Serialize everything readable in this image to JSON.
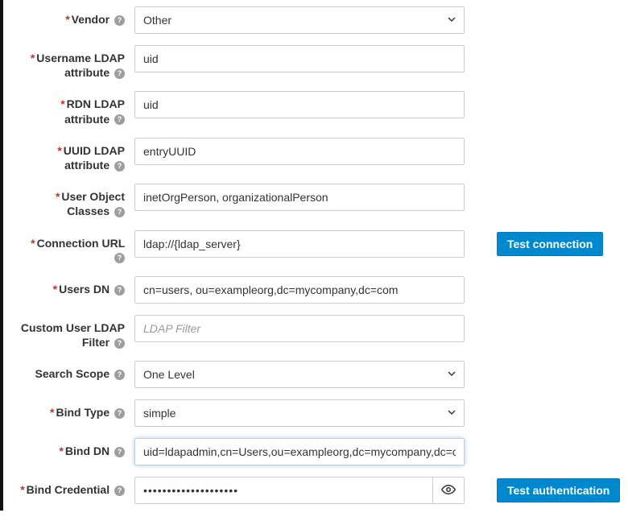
{
  "fields": {
    "vendor": {
      "label": "Vendor",
      "required": true,
      "value": "Other"
    },
    "username_attr": {
      "label": "Username LDAP attribute",
      "required": true,
      "value": "uid"
    },
    "rdn_attr": {
      "label": "RDN LDAP attribute",
      "required": true,
      "value": "uid"
    },
    "uuid_attr": {
      "label": "UUID LDAP attribute",
      "required": true,
      "value": "entryUUID"
    },
    "user_object_classes": {
      "label": "User Object Classes",
      "required": true,
      "value": "inetOrgPerson, organizationalPerson"
    },
    "connection_url": {
      "label": "Connection URL",
      "required": true,
      "value": "ldap://{ldap_server}"
    },
    "users_dn": {
      "label": "Users DN",
      "required": true,
      "value": "cn=users, ou=exampleorg,dc=mycompany,dc=com"
    },
    "custom_filter": {
      "label": "Custom User LDAP Filter",
      "required": false,
      "value": "",
      "placeholder": "LDAP Filter"
    },
    "search_scope": {
      "label": "Search Scope",
      "required": false,
      "value": "One Level"
    },
    "bind_type": {
      "label": "Bind Type",
      "required": true,
      "value": "simple"
    },
    "bind_dn": {
      "label": "Bind DN",
      "required": true,
      "value": "uid=ldapadmin,cn=Users,ou=exampleorg,dc=mycompany,dc=com"
    },
    "bind_credential": {
      "label": "Bind Credential",
      "required": true,
      "value": "••••••••••••••••••••"
    }
  },
  "buttons": {
    "test_connection": "Test connection",
    "test_authentication": "Test authentication"
  },
  "required_marker": "*"
}
